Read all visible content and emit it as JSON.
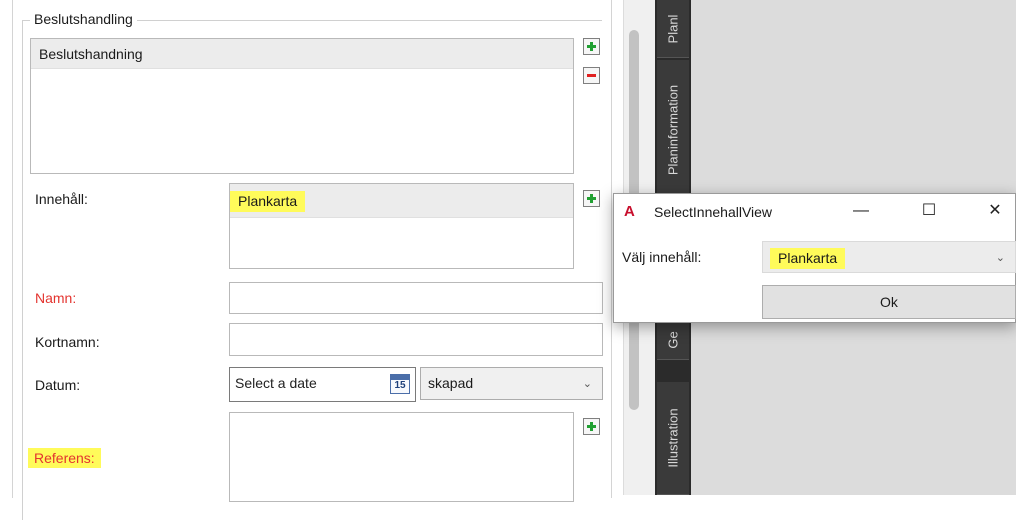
{
  "group": {
    "title": "Beslutshandling"
  },
  "beslut_list": {
    "items": [
      "Beslutshandning"
    ]
  },
  "fields": {
    "innehall_label": "Innehåll:",
    "innehall_items": [
      "Plankarta"
    ],
    "namn_label": "Namn:",
    "namn_value": "",
    "kortnamn_label": "Kortnamn:",
    "kortnamn_value": "",
    "datum_label": "Datum:",
    "datum_placeholder": "Select a date",
    "calendar_day": "15",
    "datum_type": "skapad",
    "referens_label": "Referens:"
  },
  "side_tabs": [
    "Planl",
    "Planinformation",
    "Ge",
    "Illustration"
  ],
  "dialog": {
    "title": "SelectInnehallView",
    "valj_label": "Välj innehåll:",
    "selected": "Plankarta",
    "ok_label": "Ok",
    "minimize_glyph": "—",
    "maximize_glyph": "☐",
    "close_glyph": "✕"
  },
  "icons": {
    "app": "autocad-icon",
    "add": "plus-icon",
    "remove": "minus-icon",
    "calendar": "calendar-icon",
    "dropdown": "chevron-down-icon"
  },
  "colors": {
    "highlight": "#fffb5a",
    "required_label": "#e3342f",
    "add_green": "#21a032",
    "remove_red": "#e02020",
    "tab_bar": "#2b2b2b"
  }
}
